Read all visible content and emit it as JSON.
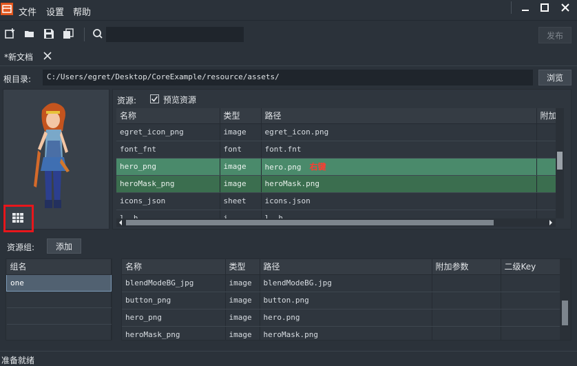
{
  "menu": {
    "file": "文件",
    "settings": "设置",
    "help": "帮助"
  },
  "toolbar": {
    "search_placeholder": "",
    "publish_label": "发布"
  },
  "tabs": [
    {
      "label": "*新文档"
    }
  ],
  "root": {
    "label": "根目录:",
    "path": "C:/Users/egret/Desktop/CoreExample/resource/assets/",
    "browse_label": "浏览"
  },
  "resources": {
    "label": "资源:",
    "preview_checkbox_label": "预览资源",
    "preview_checked": true,
    "columns": [
      "名称",
      "类型",
      "路径",
      "附加参"
    ],
    "rows": [
      {
        "name": "egret_icon_png",
        "type": "image",
        "path": "egret_icon.png"
      },
      {
        "name": "font_fnt",
        "type": "font",
        "path": "font.fnt"
      },
      {
        "name": "hero_png",
        "type": "image",
        "path": "hero.png"
      },
      {
        "name": "heroMask_png",
        "type": "image",
        "path": "heroMask.png"
      },
      {
        "name": "icons_json",
        "type": "sheet",
        "path": "icons.json"
      },
      {
        "name": "l..h...",
        "type": "i...",
        "path": "l..h..."
      }
    ],
    "right_click_note": "右键"
  },
  "groups": {
    "label": "资源组:",
    "add_label": "添加",
    "list_header": "组名",
    "items": [
      "one",
      "",
      "",
      ""
    ]
  },
  "group_resources": {
    "columns": [
      "名称",
      "类型",
      "路径",
      "附加参数",
      "二级Key"
    ],
    "rows": [
      {
        "name": "blendModeBG_jpg",
        "type": "image",
        "path": "blendModeBG.jpg"
      },
      {
        "name": "button_png",
        "type": "image",
        "path": "button.png"
      },
      {
        "name": "hero_png",
        "type": "image",
        "path": "hero.png"
      },
      {
        "name": "heroMask_png",
        "type": "image",
        "path": "heroMask.png"
      }
    ]
  },
  "status": {
    "text": "准备就绪"
  },
  "colors": {
    "highlight_row": "#4a8a6b",
    "selected_row": "#3b6e4f",
    "annotation_red": "#e8161b"
  }
}
